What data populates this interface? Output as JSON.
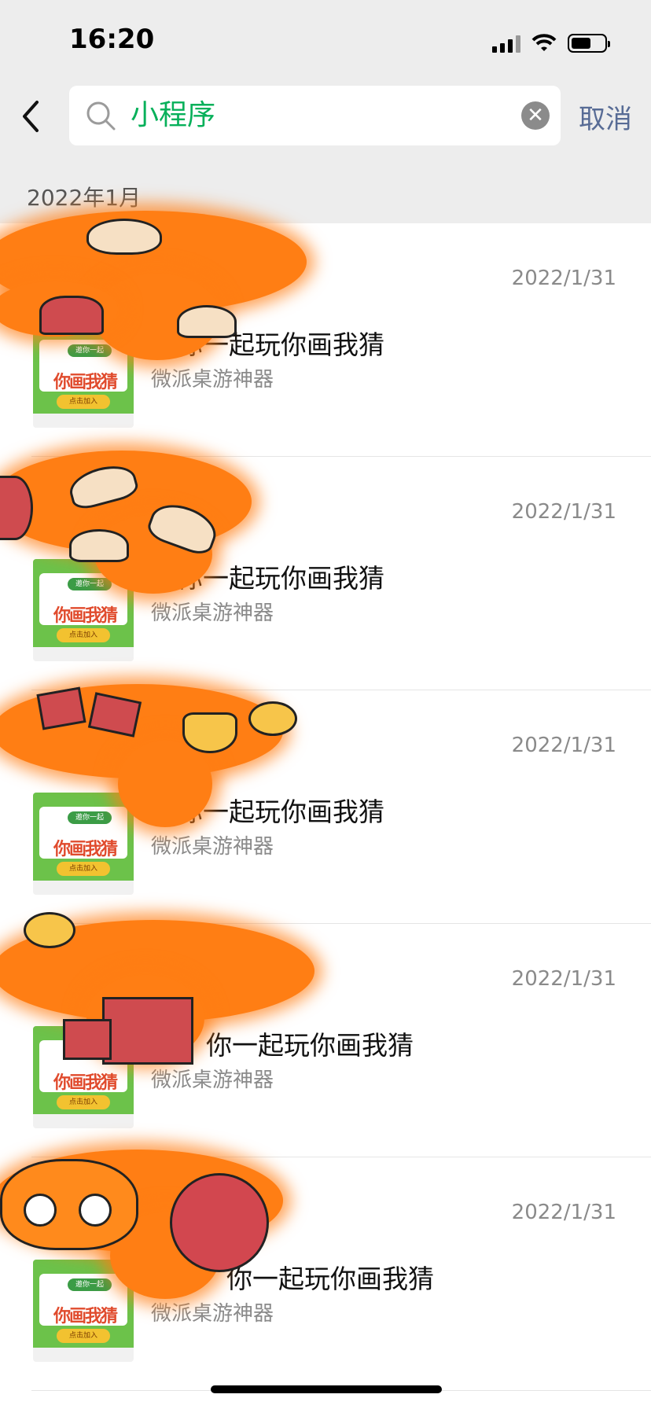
{
  "status_bar": {
    "time": "16:20"
  },
  "search": {
    "query": "小程序",
    "cancel_label": "取消"
  },
  "section": {
    "header": "2022年1月"
  },
  "items": [
    {
      "date": "2022/1/31",
      "title": "邀你一起玩你画我猜",
      "subtitle": "微派桌游神器"
    },
    {
      "date": "2022/1/31",
      "title": "邀你一起玩你画我猜",
      "subtitle": "微派桌游神器"
    },
    {
      "date": "2022/1/31",
      "title": "邀你一起玩你画我猜",
      "subtitle": "微派桌游神器"
    },
    {
      "date": "2022/1/31",
      "title": "你一起玩你画我猜",
      "subtitle": "微派桌游神器"
    },
    {
      "date": "2022/1/31",
      "title": "你一起玩你画我猜",
      "subtitle": "微派桌游神器"
    }
  ],
  "thumbnail": {
    "top": "邀你一起",
    "big": "你画我猜",
    "button": "点击加入"
  },
  "colors": {
    "accent": "#07b05a",
    "link": "#576b95",
    "header_bg": "#ededed",
    "redaction": "#ff7e14"
  },
  "icons": {
    "back": "chevron-left-icon",
    "search": "search-icon",
    "clear": "clear-icon"
  }
}
